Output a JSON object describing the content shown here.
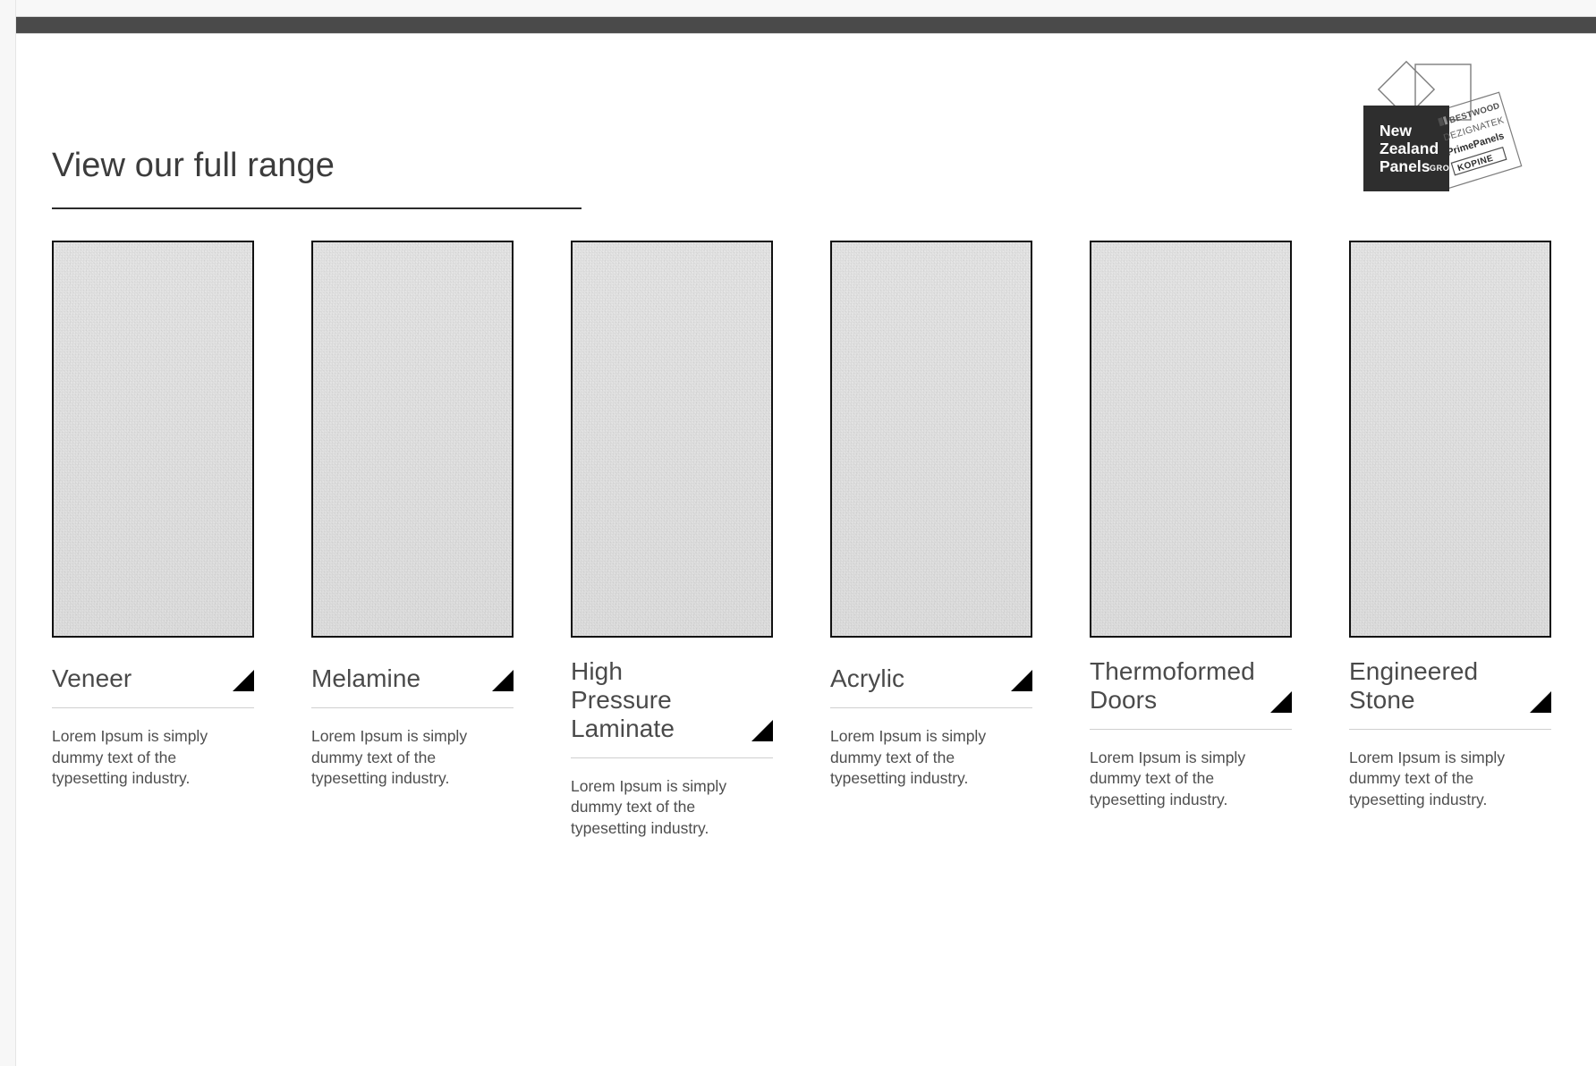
{
  "window": {
    "top_bar_color": "#4a4a4a",
    "background_color": "#ffffff"
  },
  "header": {
    "title": "View our full range"
  },
  "logo": {
    "line1": "New",
    "line2": "Zealand",
    "line3": "Panels",
    "group_word": "GROUP",
    "brands": [
      "BESTWOOD",
      "DEZIGNATEK",
      "PrimePanels",
      "KOPINE"
    ],
    "bestwood_superscript": "®",
    "primepanels_superscript": "™",
    "box_color": "#2e2e2e"
  },
  "cards": [
    {
      "title": "Veneer",
      "body": "Lorem Ipsum is simply dummy text of the typesetting industry.",
      "icon": "corner-triangle-icon"
    },
    {
      "title": "Melamine",
      "body": "Lorem Ipsum is simply dummy text of the typesetting industry.",
      "icon": "corner-triangle-icon"
    },
    {
      "title": "High Pressure Laminate",
      "body": "Lorem Ipsum is simply dummy text of the typesetting industry.",
      "icon": "corner-triangle-icon"
    },
    {
      "title": "Acrylic",
      "body": "Lorem Ipsum is simply dummy text of the typesetting industry.",
      "icon": "corner-triangle-icon"
    },
    {
      "title": "Thermoformed Doors",
      "body": "Lorem Ipsum is simply dummy text of the typesetting industry.",
      "icon": "corner-triangle-icon"
    },
    {
      "title": "Engineered Stone",
      "body": "Lorem Ipsum is simply dummy text of the typesetting industry.",
      "icon": "corner-triangle-icon"
    }
  ]
}
